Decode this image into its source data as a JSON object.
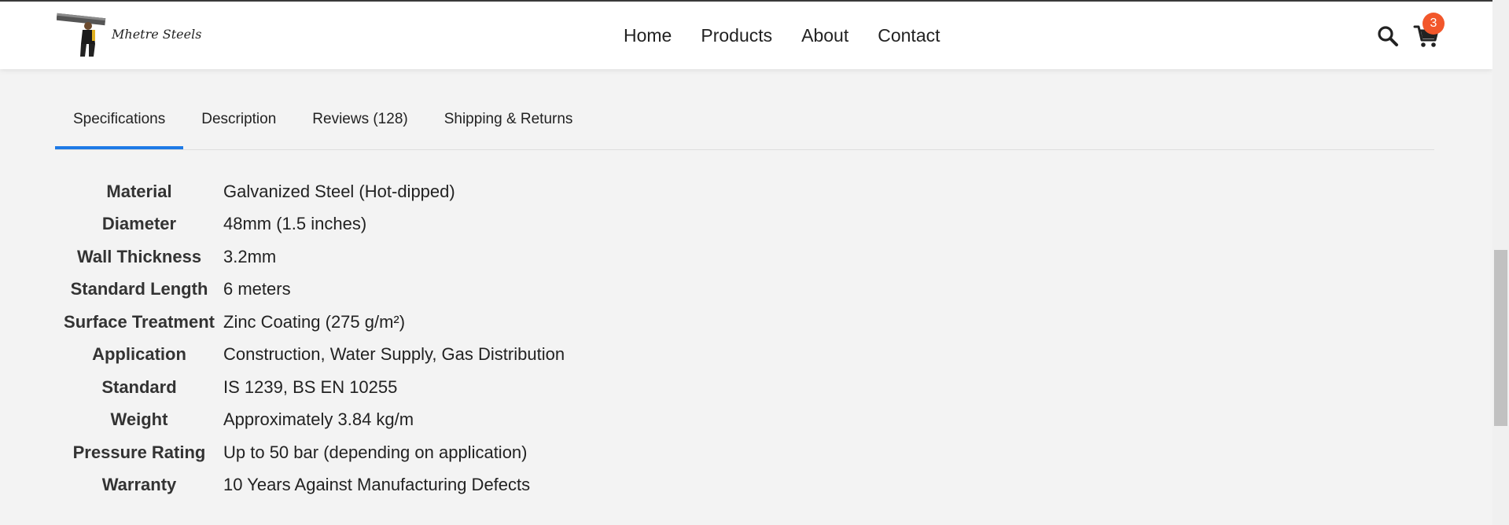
{
  "brand": {
    "name": "Mhetre Steels"
  },
  "nav": {
    "items": [
      "Home",
      "Products",
      "About",
      "Contact"
    ]
  },
  "header_actions": {
    "search_icon": "search-icon",
    "cart_icon": "cart-icon",
    "cart_count": "3"
  },
  "tabs": [
    {
      "label": "Specifications",
      "active": true
    },
    {
      "label": "Description",
      "active": false
    },
    {
      "label": "Reviews (128)",
      "active": false
    },
    {
      "label": "Shipping & Returns",
      "active": false
    }
  ],
  "specs": [
    {
      "key": "Material",
      "value": "Galvanized Steel (Hot-dipped)"
    },
    {
      "key": "Diameter",
      "value": "48mm (1.5 inches)"
    },
    {
      "key": "Wall Thickness",
      "value": "3.2mm"
    },
    {
      "key": "Standard Length",
      "value": "6 meters"
    },
    {
      "key": "Surface Treatment",
      "value": "Zinc Coating (275 g/m²)"
    },
    {
      "key": "Application",
      "value": "Construction, Water Supply, Gas Distribution"
    },
    {
      "key": "Standard",
      "value": "IS 1239, BS EN 10255"
    },
    {
      "key": "Weight",
      "value": "Approximately 3.84 kg/m"
    },
    {
      "key": "Pressure Rating",
      "value": "Up to 50 bar (depending on application)"
    },
    {
      "key": "Warranty",
      "value": "10 Years Against Manufacturing Defects"
    }
  ],
  "colors": {
    "accent": "#1e7ae6",
    "badge": "#f2572b",
    "background": "#f3f3f3"
  }
}
